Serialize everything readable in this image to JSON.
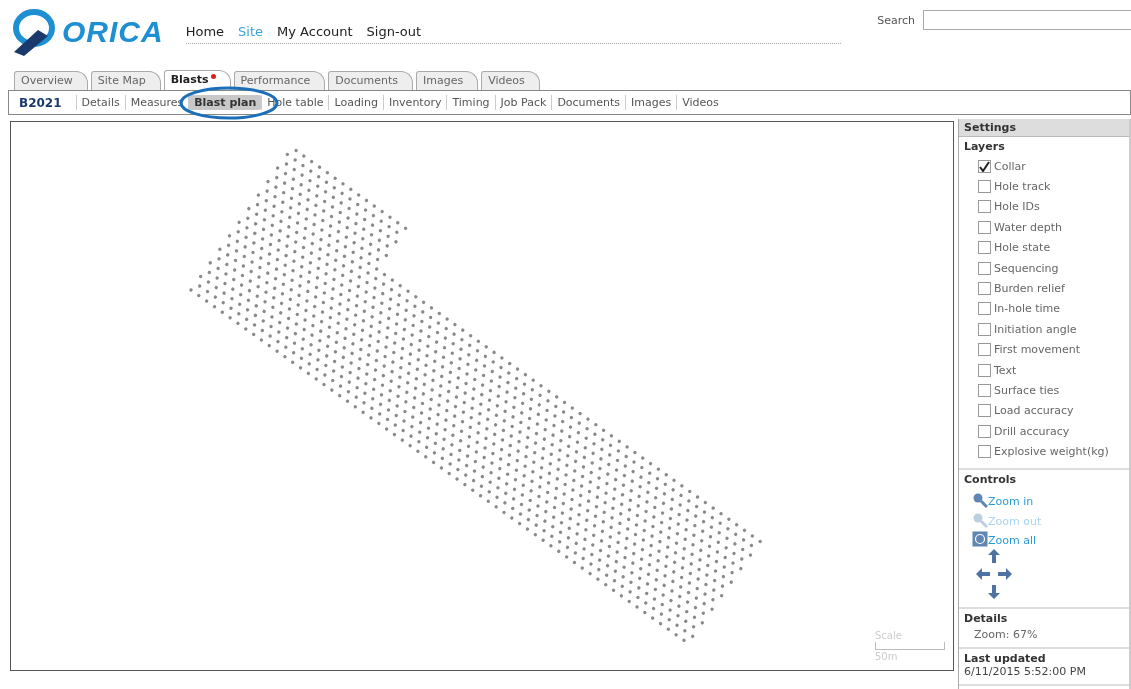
{
  "header": {
    "logo_text": "ORICA",
    "nav": [
      {
        "label": "Home",
        "selected": false
      },
      {
        "label": "Site",
        "selected": true
      },
      {
        "label": "My Account",
        "selected": false
      },
      {
        "label": "Sign-out",
        "selected": false
      }
    ],
    "search": {
      "label": "Search"
    }
  },
  "tabs": [
    {
      "label": "Overview",
      "selected": false,
      "alert": false
    },
    {
      "label": "Site Map",
      "selected": false,
      "alert": false
    },
    {
      "label": "Blasts",
      "selected": true,
      "alert": true
    },
    {
      "label": "Performance",
      "selected": false,
      "alert": false
    },
    {
      "label": "Documents",
      "selected": false,
      "alert": false
    },
    {
      "label": "Images",
      "selected": false,
      "alert": false
    },
    {
      "label": "Videos",
      "selected": false,
      "alert": false
    }
  ],
  "subnav": {
    "blast_id": "B2021",
    "items": [
      {
        "label": "Details",
        "selected": false
      },
      {
        "label": "Measures",
        "selected": false
      },
      {
        "label": "Blast plan",
        "selected": true
      },
      {
        "label": "Hole table",
        "selected": false
      },
      {
        "label": "Loading",
        "selected": false
      },
      {
        "label": "Inventory",
        "selected": false
      },
      {
        "label": "Timing",
        "selected": false
      },
      {
        "label": "Job Pack",
        "selected": false
      },
      {
        "label": "Documents",
        "selected": false
      },
      {
        "label": "Images",
        "selected": false
      },
      {
        "label": "Videos",
        "selected": false
      }
    ]
  },
  "map": {
    "scale": {
      "label": "Scale",
      "distance": "50m"
    }
  },
  "settings": {
    "title": "Settings",
    "layers": {
      "title": "Layers",
      "items": [
        {
          "label": "Collar",
          "checked": true
        },
        {
          "label": "Hole track",
          "checked": false
        },
        {
          "label": "Hole IDs",
          "checked": false
        },
        {
          "label": "Water depth",
          "checked": false
        },
        {
          "label": "Hole state",
          "checked": false
        },
        {
          "label": "Sequencing",
          "checked": false
        },
        {
          "label": "Burden relief",
          "checked": false
        },
        {
          "label": "In-hole time",
          "checked": false
        },
        {
          "label": "Initiation angle",
          "checked": false
        },
        {
          "label": "First movement",
          "checked": false
        },
        {
          "label": "Text",
          "checked": false
        },
        {
          "label": "Surface ties",
          "checked": false
        },
        {
          "label": "Load accuracy",
          "checked": false
        },
        {
          "label": "Drill accuracy",
          "checked": false
        },
        {
          "label": "Explosive weight(kg)",
          "checked": false
        }
      ]
    },
    "controls": {
      "title": "Controls",
      "zoom": [
        {
          "label": "Zoom in",
          "kind": "zoom-in",
          "disabled": false
        },
        {
          "label": "Zoom out",
          "kind": "zoom-out",
          "disabled": true
        },
        {
          "label": "Zoom all",
          "kind": "zoom-all",
          "disabled": false
        }
      ]
    },
    "details": {
      "title": "Details",
      "zoom": "Zoom: 67%"
    },
    "last_updated": {
      "title": "Last updated",
      "value": "6/11/2015 5:52:00 PM"
    }
  }
}
